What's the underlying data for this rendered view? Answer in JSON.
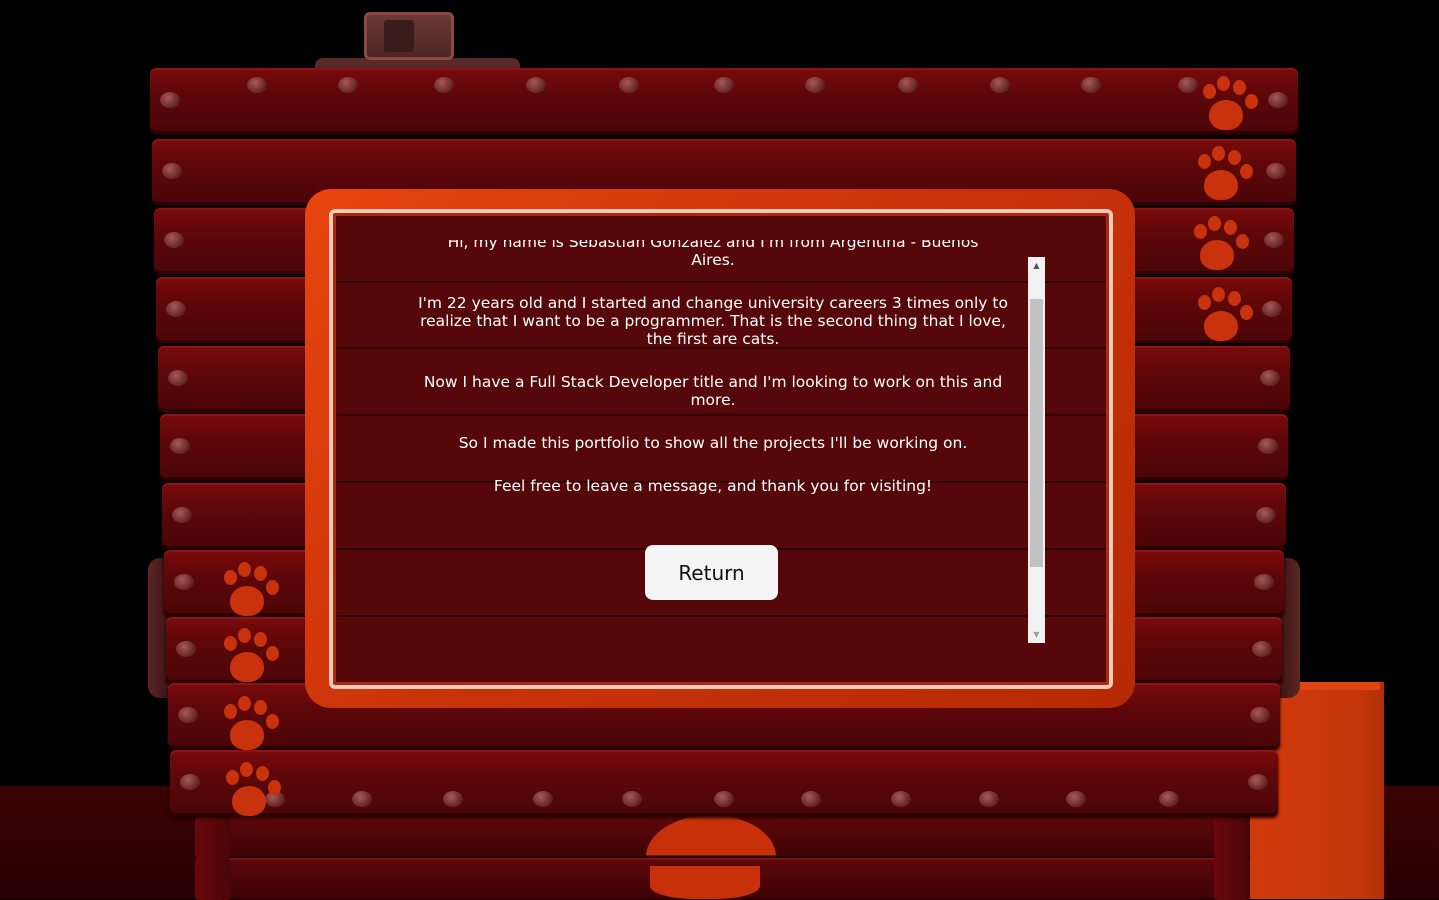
{
  "about": {
    "partial_line": "Hi, my name is Sebastian Gonzalez and I'm from Argentina - Buenos",
    "paragraphs": [
      "Aires.",
      "I'm 22 years old and I started and change university careers 3 times only to realize that I want to be a programmer. That is the second thing that I love, the first are cats.",
      "Now I have a Full Stack Developer title and I'm looking to work on this and more.",
      "So I made this portfolio to show all the projects I'll be working on.",
      "Feel free to leave a message, and thank you for visiting!"
    ],
    "return_label": "Return"
  },
  "scrollbar": {
    "up_arrow": "▲",
    "down_arrow": "▼",
    "position": 0.3
  },
  "colors": {
    "plank": "#5e0709",
    "frame": "#d23a0c",
    "paw": "#c8320c",
    "button_bg": "#f5f5f5"
  },
  "icons": {
    "paw": "paw-print-icon",
    "rivet": "rivet-icon",
    "buckle": "buckle-icon"
  }
}
